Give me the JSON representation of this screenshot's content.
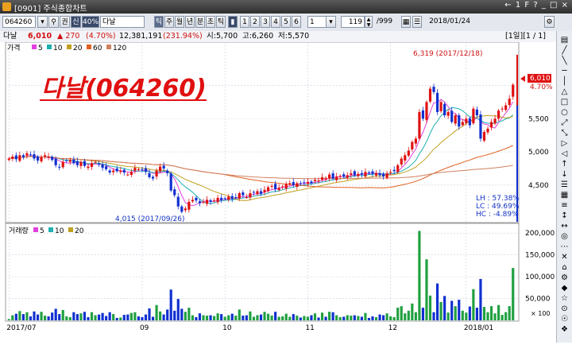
{
  "window": {
    "title": "[0901] 주식종합차트",
    "controls": "← 1 F ? _ □ ×"
  },
  "toolbar": {
    "code": "064260",
    "btn_won": "권",
    "btn_new": "신",
    "btn_40": "40%",
    "name": "다날",
    "periods": [
      "틱",
      "주",
      "월",
      "년",
      "분",
      "초",
      "틱"
    ],
    "numbers": [
      "1",
      "2",
      "3",
      "4",
      "5",
      "6"
    ],
    "interval": "1",
    "count": "119",
    "max": "999",
    "date": "2018/01/24"
  },
  "info": {
    "name": "다날",
    "price": "6,010",
    "change": "▲ 270",
    "pct": "(4.70%)",
    "volume": "12,381,191",
    "turnover": "(231.94%)",
    "open": "시:5,700",
    "high": "고:6,260",
    "low": "저:5,570",
    "page": "[1일][1 / 1]"
  },
  "price_legend": {
    "label": "가격",
    "items": [
      {
        "text": "5",
        "color": "#e040e0"
      },
      {
        "text": "10",
        "color": "#20b0b0"
      },
      {
        "text": "20",
        "color": "#c0a020"
      },
      {
        "text": "60",
        "color": "#e06020"
      },
      {
        "text": "120",
        "color": "#d08060"
      }
    ]
  },
  "volume_legend": {
    "label": "거래량",
    "items": [
      {
        "text": "5",
        "color": "#e040e0"
      },
      {
        "text": "10",
        "color": "#20b0b0"
      },
      {
        "text": "20",
        "color": "#c0a020"
      }
    ]
  },
  "overlay_title": "다날(064260)",
  "annotations": {
    "high": "6,319 (2017/12/18)",
    "low": "4,015 (2017/09/26)"
  },
  "current_tag": {
    "price": "6,010",
    "pct": "4.70%"
  },
  "stats": {
    "lh": "LH : 57.38%",
    "lc": "LC : 49.69%",
    "hc": "HC : -4.89%"
  },
  "chart_data": {
    "type": "candlestick",
    "price_axis": {
      "ticks": [
        4500,
        5000,
        5500,
        6000
      ],
      "labels": [
        "4,500",
        "5,000",
        "5,500"
      ],
      "range": [
        3950,
        6650
      ]
    },
    "volume_axis": {
      "ticks": [
        0,
        50000,
        100000,
        150000,
        200000
      ],
      "labels": [
        "50,000",
        "100,000",
        "150,000",
        "200,000"
      ],
      "range": [
        0,
        215000
      ],
      "unit": "× 100"
    },
    "x_labels": [
      "2017/07",
      "09",
      "10",
      "11",
      "12",
      "2018/01"
    ],
    "x_label_index": [
      0,
      37,
      60,
      83,
      106,
      127
    ],
    "series": [
      {
        "name": "price",
        "values": [
          4900,
          4930,
          4890,
          4950,
          4920,
          4980,
          4960,
          4900,
          4870,
          4920,
          4950,
          4930,
          4880,
          4800,
          4770,
          4850,
          4870,
          4880,
          4830,
          4800,
          4850,
          4790,
          4780,
          4830,
          4850,
          4810,
          4760,
          4740,
          4690,
          4720,
          4710,
          4720,
          4690,
          4660,
          4700,
          4760,
          4740,
          4730,
          4700,
          4620,
          4600,
          4720,
          4780,
          4750,
          4680,
          4420,
          4350,
          4180,
          4100,
          4150,
          4250,
          4280,
          4270,
          4230,
          4250,
          4280,
          4250,
          4270,
          4310,
          4280,
          4300,
          4330,
          4290,
          4310,
          4380,
          4350,
          4320,
          4380,
          4390,
          4410,
          4370,
          4430,
          4470,
          4490,
          4440,
          4460,
          4480,
          4520,
          4530,
          4500,
          4530,
          4520,
          4540,
          4550,
          4530,
          4580,
          4570,
          4620,
          4610,
          4660,
          4600,
          4630,
          4640,
          4630,
          4650,
          4680,
          4650,
          4670,
          4660,
          4700,
          4690,
          4670,
          4680,
          4650,
          4630,
          4680,
          4700,
          4710,
          4800,
          4900,
          4950,
          5020,
          5150,
          5200,
          5600,
          5500,
          5750,
          5950,
          5900,
          5600,
          5750,
          5550,
          5600,
          5450,
          5550,
          5380,
          5450,
          5500,
          5400,
          5650,
          5550,
          5200,
          5300,
          5350,
          5450,
          5500,
          5620,
          5650,
          5700,
          5800,
          6010
        ]
      }
    ]
  }
}
